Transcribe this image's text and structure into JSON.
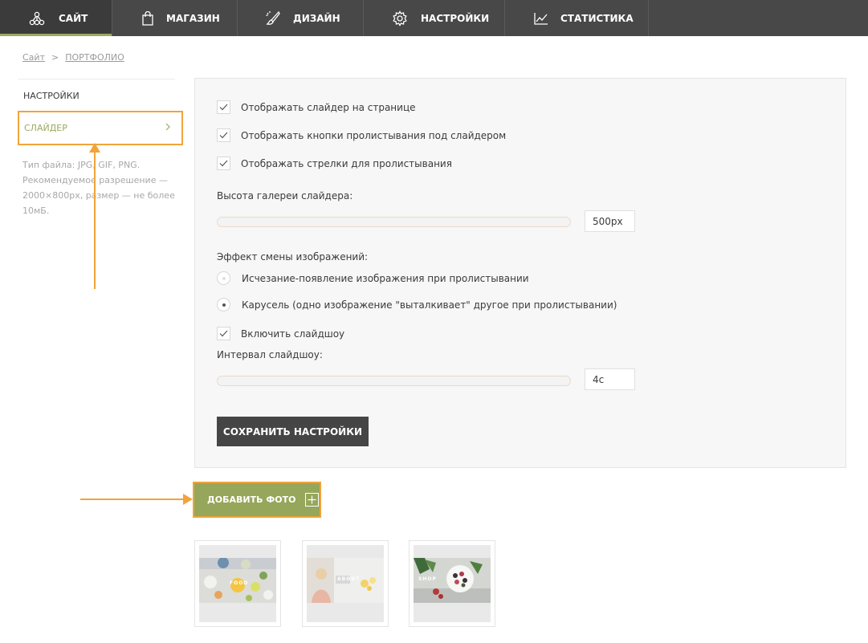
{
  "nav": {
    "tabs": [
      {
        "label": "САЙТ",
        "icon": "network-icon",
        "active": true
      },
      {
        "label": "МАГАЗИН",
        "icon": "shopping-bag-icon"
      },
      {
        "label": "ДИЗАЙН",
        "icon": "brush-icon"
      },
      {
        "label": "НАСТРОЙКИ",
        "icon": "gear-icon"
      },
      {
        "label": "СТАТИСТИКА",
        "icon": "line-chart-icon"
      }
    ]
  },
  "breadcrumb": {
    "root": "Сайт",
    "separator": ">",
    "current": "ПОРТФОЛИО"
  },
  "sidebar": {
    "items": [
      {
        "label": "НАСТРОЙКИ"
      },
      {
        "label": "СЛАЙДЕР",
        "active": true
      }
    ],
    "note": "Тип файла: JPG, GIF, PNG. Рекомендуемое разрешение — 2000×800px, размер — не более 10мБ."
  },
  "settings": {
    "checkboxes": [
      {
        "label": "Отображать слайдер на странице",
        "checked": true
      },
      {
        "label": "Отображать кнопки пролистывания под слайдером",
        "checked": true
      },
      {
        "label": "Отображать стрелки для пролистывания",
        "checked": true
      }
    ],
    "height_label": "Высота галереи слайдера:",
    "height_value": "500px",
    "effect_label": "Эффект смены изображений:",
    "effects": [
      {
        "label": "Исчезание-появление изображения при пролистывании",
        "selected": false
      },
      {
        "label": "Карусель (одно изображение \"выталкивает\" другое при пролистывании)",
        "selected": true
      }
    ],
    "slideshow_label": "Включить слайдшоу",
    "slideshow_checked": true,
    "interval_label": "Интервал слайдшоу:",
    "interval_value": "4с",
    "save_label": "СОХРАНИТЬ НАСТРОЙКИ"
  },
  "add_photo_label": "ДОБАВИТЬ ФОТО",
  "thumbnails": [
    {
      "caption": "FOOD"
    },
    {
      "caption": "ABOUT"
    },
    {
      "caption": "SHOP"
    }
  ],
  "colors": {
    "accent": "#9aaa61",
    "highlight": "#f1a43a",
    "nav_bg": "#484848",
    "button_dark": "#454545"
  }
}
